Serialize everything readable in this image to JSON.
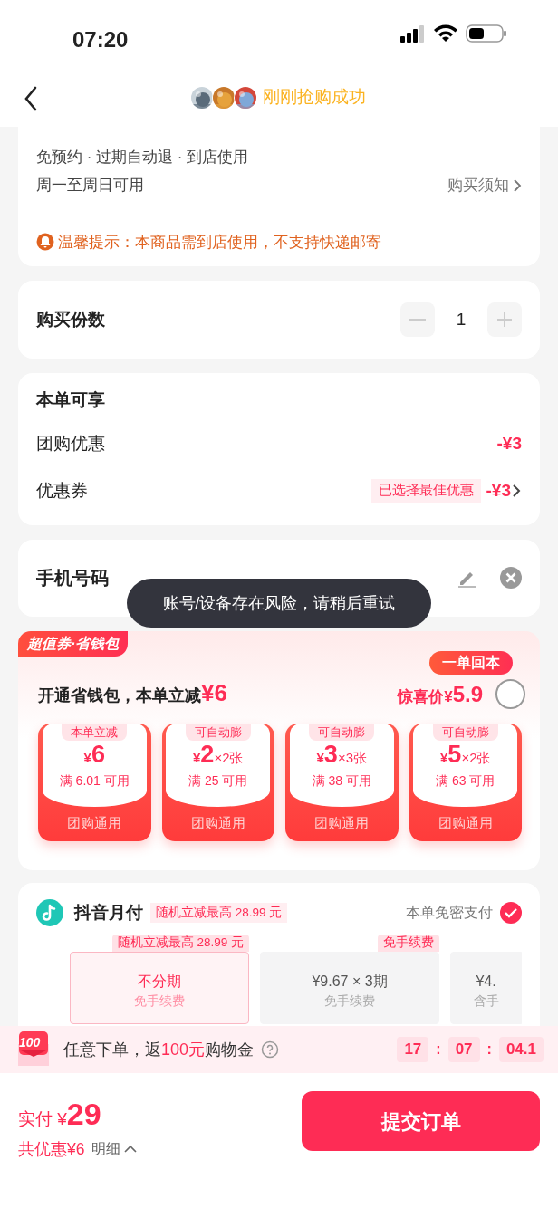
{
  "status_bar": {
    "time": "07:20"
  },
  "header": {
    "title": "刚刚抢购成功"
  },
  "deal_info": {
    "lines": [
      "免预约 · 过期自动退 · 到店使用",
      "周一至周日可用"
    ],
    "notice_link": "购买须知",
    "tip": "温馨提示：本商品需到店使用，不支持快递邮寄"
  },
  "quantity": {
    "label": "购买份数",
    "value": "1",
    "minus_disabled": true,
    "plus_disabled": true
  },
  "discounts": {
    "title": "本单可享",
    "rows": [
      {
        "label": "团购优惠",
        "value": "-¥3",
        "link": false
      },
      {
        "label": "优惠券",
        "tag": "已选择最佳优惠",
        "value": "-¥3",
        "link": true
      }
    ]
  },
  "phone": {
    "label": "手机号码"
  },
  "toast": "账号/设备存在风险，请稍后重试",
  "wallet": {
    "badge": "超值券·省钱包",
    "headline": "开通省钱包，本单立减",
    "headline_amount": "¥6",
    "bubble": "一单回本",
    "price_label": "惊喜价",
    "price_currency": "¥",
    "price": "5.9",
    "selected": false,
    "coupons": [
      {
        "tag": "本单立减",
        "currency": "¥",
        "amount": "6",
        "condition": "满 6.01 可用",
        "footer": "团购通用"
      },
      {
        "tag": "可自动膨",
        "currency": "¥",
        "amount": "2",
        "count": "×2张",
        "condition": "满 25 可用",
        "footer": "团购通用"
      },
      {
        "tag": "可自动膨",
        "currency": "¥",
        "amount": "3",
        "count": "×3张",
        "condition": "满 38 可用",
        "footer": "团购通用"
      },
      {
        "tag": "可自动膨",
        "currency": "¥",
        "amount": "5",
        "count": "×2张",
        "condition": "满 63 可用",
        "footer": "团购通用"
      }
    ]
  },
  "payment": {
    "name": "抖音月付",
    "tag": "随机立减最高 28.99 元",
    "password_free": "本单免密支付",
    "checked": true,
    "options": [
      {
        "badge": "随机立减最高 28.99 元",
        "main": "不分期",
        "sub": "免手续费",
        "selected": true
      },
      {
        "badge": "免手续费",
        "main": "¥9.67 × 3期",
        "sub": "免手续费",
        "selected": false
      },
      {
        "main": "¥4.",
        "sub": "含手",
        "selected": false
      }
    ]
  },
  "promo": {
    "icon_text": "100",
    "text_before": "任意下单，返",
    "highlight": "100元",
    "text_after": "购物金",
    "countdown": [
      {
        "kind": "digits",
        "text": "17"
      },
      {
        "kind": "sep",
        "text": ":"
      },
      {
        "kind": "digits",
        "text": "07"
      },
      {
        "kind": "sep",
        "text": ":"
      },
      {
        "kind": "digits",
        "text": "04.1"
      }
    ]
  },
  "footer": {
    "pay_label": "实付",
    "pay_currency": "¥",
    "pay_amount": "29",
    "saving": "共优惠¥6",
    "detail": "明细",
    "submit": "提交订单"
  }
}
